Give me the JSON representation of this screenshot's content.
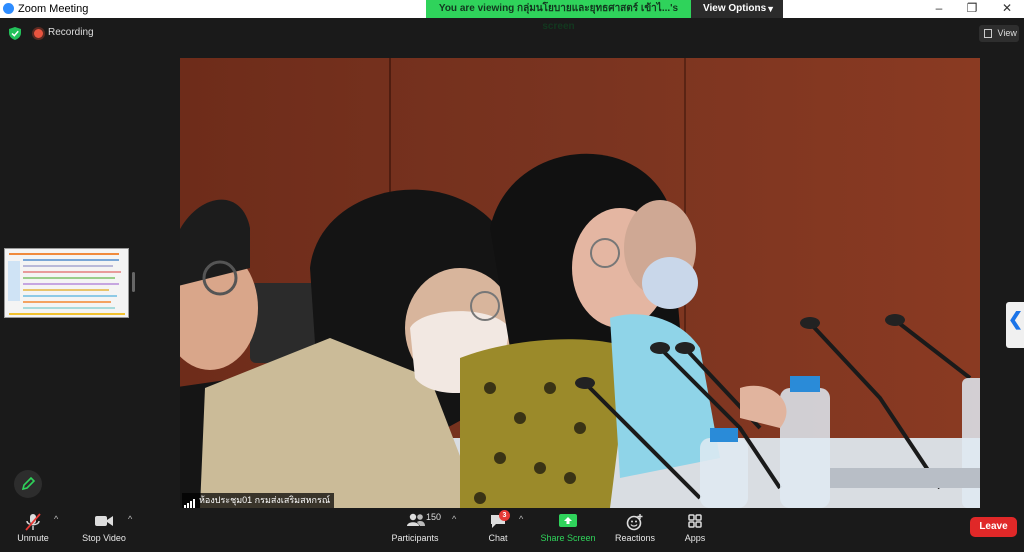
{
  "window": {
    "title": "Zoom Meeting",
    "minimize_glyph": "–",
    "restore_glyph": "❐",
    "close_glyph": "✕"
  },
  "share_banner": {
    "text": "You are viewing กลุ่มนโยบายและยุทธศาสตร์ เข้าไ...'s screen",
    "view_options": "View Options",
    "color": "#2fd35b"
  },
  "topbar": {
    "recording_label": "Recording",
    "view_label": "View"
  },
  "video": {
    "participant_name": "ห้องประชุม01 กรมส่งเสริมสหกรณ์"
  },
  "toolbar": {
    "unmute": "Unmute",
    "stop_video": "Stop Video",
    "participants": "Participants",
    "participants_count": "150",
    "chat": "Chat",
    "chat_badge": "3",
    "share_screen": "Share Screen",
    "reactions": "Reactions",
    "apps": "Apps",
    "leave": "Leave",
    "accent_green": "#2fd35b",
    "leave_color": "#e02828"
  },
  "edge_tab": {
    "glyph": "❮"
  },
  "caret_glyph": "^"
}
